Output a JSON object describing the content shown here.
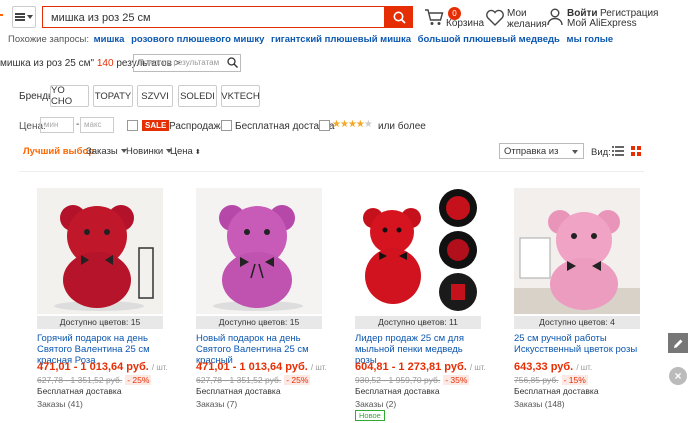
{
  "header": {
    "search_value": "мишка из роз 25 см",
    "cart_count": "0",
    "cart_label": "Корзина",
    "wish_label_1": "Мои",
    "wish_label_2": "желания",
    "login": "Войти",
    "register": "Регистрация",
    "my_account": "Мой AliExpress"
  },
  "similar": {
    "label": "Похожие запросы:",
    "items": [
      "мишка",
      "розового плюшевого мишку",
      "гигантский плюшевый мишка",
      "большой плюшевый медведь",
      "мы голые"
    ]
  },
  "breadcrumb": {
    "query": "мишка из роз 25 см\"",
    "count": "140",
    "suffix": "результатов >",
    "in_results_placeholder": "Поиск по результатам"
  },
  "brands": {
    "label": "Бренды:",
    "items": [
      "YO CHO",
      "TOPATY",
      "SZVVI",
      "SOLEDI",
      "VKTECH"
    ]
  },
  "filters": {
    "price_label": "Цена:",
    "min_placeholder": "мин",
    "max_placeholder": "макс",
    "sale_tag": "SALE",
    "sale_label": "Распродажа",
    "free_ship_label": "Бесплатная доставка",
    "rating_stars": 4,
    "rating_label": "или более"
  },
  "sort": {
    "best": "Лучший выбор",
    "orders": "Заказы",
    "new": "Новинки",
    "price": "Цена",
    "ship_from": "Отправка из",
    "view_label": "Вид:"
  },
  "products": [
    {
      "colors": "Доступно цветов: 15",
      "title": "Горячий подарок на день Святого Валентина 25 см красная Роза",
      "price": "471,01 - 1 013,64 руб.",
      "unit": "/ шт.",
      "old_price": "627,78 - 1 351,52 руб.",
      "discount": "- 25%",
      "shipping": "Бесплатная доставка",
      "orders": "Заказы (41)",
      "image_color": "#c0172a"
    },
    {
      "colors": "Доступно цветов: 15",
      "title": "Новый подарок на день Святого Валентина 25 см красный",
      "price": "471,01 - 1 013,64 руб.",
      "unit": "/ шт.",
      "old_price": "627,78 - 1 351,52 руб.",
      "discount": "- 25%",
      "shipping": "Бесплатная доставка",
      "orders": "Заказы (7)",
      "image_color": "#c85ab8"
    },
    {
      "colors": "Доступно цветов: 11",
      "title": "Лидер продаж 25 см для мыльной пенки медведь розы",
      "price": "604,81 - 1 273,81 руб.",
      "unit": "/ шт.",
      "old_price": "930,52 - 1 959,70 руб.",
      "discount": "- 35%",
      "shipping": "Бесплатная доставка",
      "orders": "Заказы (2)",
      "badge": "Новое",
      "image_color": "#d5141f"
    },
    {
      "colors": "Доступно цветов: 4",
      "title": "25 см ручной работы Искусственный цветок розы",
      "price": "643,33 руб.",
      "unit": "/ шт.",
      "old_price": "756,85 руб.",
      "discount": "- 15%",
      "shipping": "Бесплатная доставка",
      "orders": "Заказы (148)",
      "image_color": "#f0a3c4"
    }
  ],
  "icons": [
    "menu-icon",
    "search-icon",
    "cart-icon",
    "heart-icon",
    "user-icon",
    "list-view-icon",
    "grid-view-icon",
    "edit-icon",
    "close-icon"
  ]
}
